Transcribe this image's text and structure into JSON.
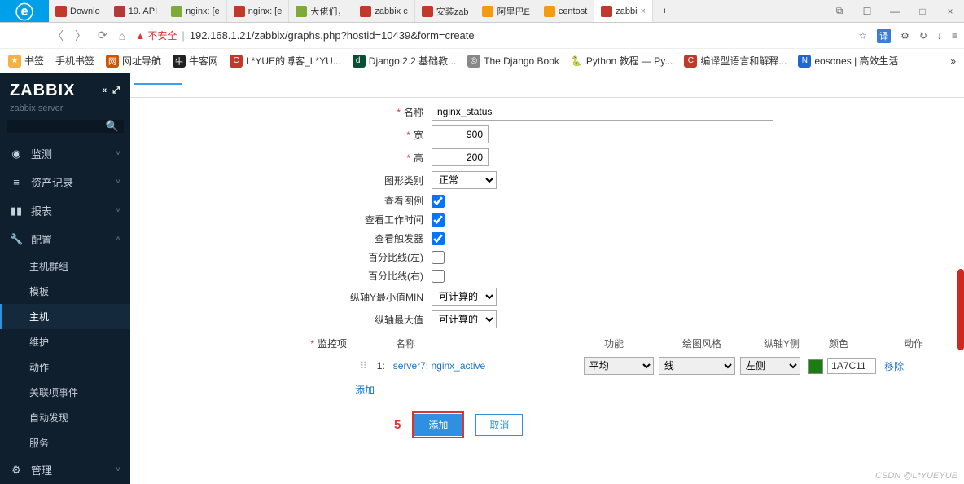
{
  "browser": {
    "tabs": [
      {
        "label": "Downlo",
        "fav": "#c0392b"
      },
      {
        "label": "19. API",
        "fav": "#b33939"
      },
      {
        "label": "nginx: [e",
        "fav": "#7eaa3a"
      },
      {
        "label": "nginx: [e",
        "fav": "#c0392b"
      },
      {
        "label": "大佬们，",
        "fav": "#7eaa3a"
      },
      {
        "label": "zabbix c",
        "fav": "#c0392b"
      },
      {
        "label": "安装zab",
        "fav": "#c0392b"
      },
      {
        "label": "阿里巴E",
        "fav": "#f39c12"
      },
      {
        "label": "centost",
        "fav": "#f39c12"
      },
      {
        "label": "zabbi",
        "fav": "#c0392b",
        "active": true,
        "close": "×"
      }
    ],
    "newtab": "+",
    "winctrl": {
      "a": "⧉",
      "b": "☐",
      "min": "—",
      "max": "□",
      "close": "×"
    }
  },
  "addr": {
    "warn": "▲ 不安全",
    "url": "192.168.1.21/zabbix/graphs.php?hostid=10439&form=create",
    "star": "☆",
    "trans": "译",
    "ext": "⚙",
    "reload": "↻",
    "down": "↓",
    "menu": "≡"
  },
  "bookmarks": [
    {
      "ico": "★",
      "bg": "#f5b041",
      "label": "书签"
    },
    {
      "ico": "",
      "bg": "",
      "label": "手机书签"
    },
    {
      "ico": "网",
      "bg": "#d35400",
      "label": "网址导航"
    },
    {
      "ico": "牛",
      "bg": "#222",
      "label": "牛客网"
    },
    {
      "ico": "C",
      "bg": "#c0392b",
      "label": "L*YUE的博客_L*YU..."
    },
    {
      "ico": "dj",
      "bg": "#0b4f32",
      "label": "Django 2.2 基础教..."
    },
    {
      "ico": "◎",
      "bg": "#888",
      "label": "The Django Book"
    },
    {
      "ico": "🐍",
      "bg": "",
      "label": "Python 教程 — Py..."
    },
    {
      "ico": "C",
      "bg": "#c0392b",
      "label": "编译型语言和解释..."
    },
    {
      "ico": "N",
      "bg": "#1e66d0",
      "label": "eosones | 高效生活"
    }
  ],
  "bm_more": "»",
  "sidebar": {
    "logo": "ZABBIX",
    "tool1": "«",
    "tool2": "⤢",
    "server": "zabbix server",
    "menu": [
      {
        "ico": "◉",
        "label": "监测",
        "chev": "˅"
      },
      {
        "ico": "≡",
        "label": "资产记录",
        "chev": "˅"
      },
      {
        "ico": "▮▮",
        "label": "报表",
        "chev": "˅"
      },
      {
        "ico": "🔧",
        "label": "配置",
        "chev": "˄",
        "open": true
      }
    ],
    "sub": [
      "主机群组",
      "模板",
      "主机",
      "维护",
      "动作",
      "关联项事件",
      "自动发现",
      "服务"
    ],
    "sub_active_index": 2,
    "admin": {
      "ico": "⚙",
      "label": "管理",
      "chev": "˅"
    }
  },
  "form": {
    "name_lbl": "名称",
    "name_val": "nginx_status",
    "width_lbl": "宽",
    "width_val": "900",
    "height_lbl": "高",
    "height_val": "200",
    "gtype_lbl": "图形类别",
    "gtype_val": "正常",
    "legend_lbl": "查看图例",
    "worktime_lbl": "查看工作时间",
    "triggers_lbl": "查看触发器",
    "pleft_lbl": "百分比线(左)",
    "pright_lbl": "百分比线(右)",
    "ymin_lbl": "纵轴Y最小值MIN",
    "ymin_val": "可计算的",
    "ymax_lbl": "纵轴最大值",
    "ymax_val": "可计算的",
    "items_lbl": "监控项",
    "th": {
      "name": "名称",
      "func": "功能",
      "style": "绘图风格",
      "side": "纵轴Y侧",
      "color": "颜色",
      "action": "动作"
    },
    "row": {
      "idx": "1:",
      "name": "server7: nginx_active",
      "func": "平均",
      "style": "线",
      "side": "左侧",
      "color": "1A7C11",
      "del": "移除"
    },
    "add_item": "添加",
    "annot": "5",
    "submit": "添加",
    "cancel": "取消"
  },
  "watermark": "CSDN @L*YUEYUE"
}
